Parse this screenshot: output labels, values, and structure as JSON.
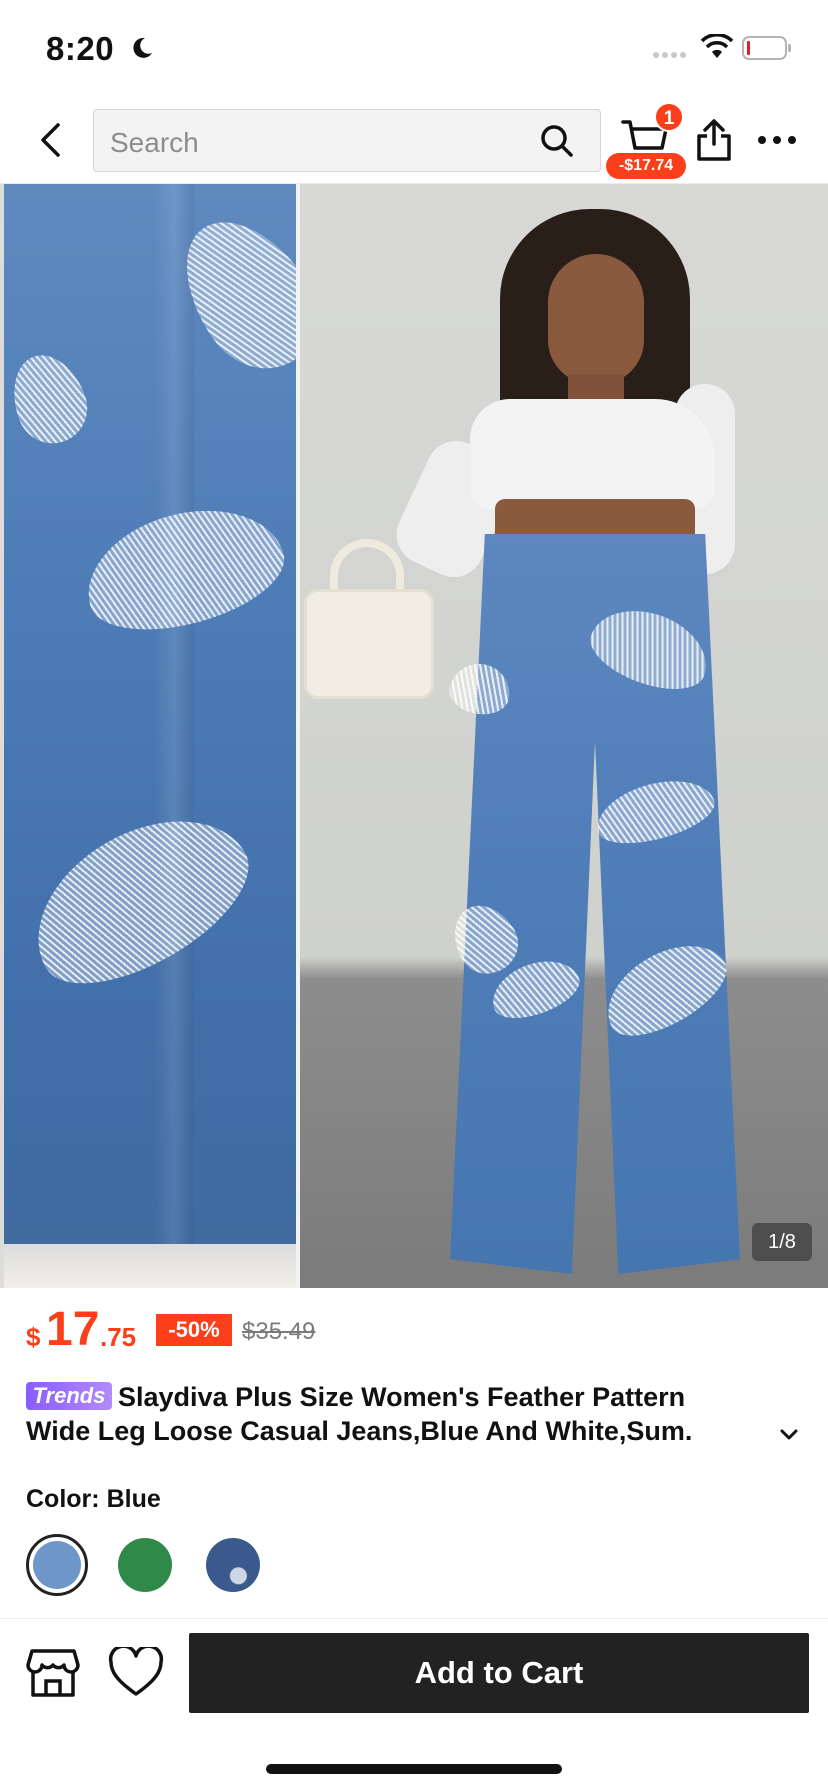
{
  "status_bar": {
    "time": "8:20"
  },
  "header": {
    "search_placeholder": "Search",
    "cart_badge_count": "1",
    "cart_discount": "-$17.74"
  },
  "gallery": {
    "page_indicator": "1/8",
    "current_page": 1,
    "total_pages": 8
  },
  "price": {
    "currency": "$",
    "integer": "17",
    "decimal": ".75",
    "discount": "-50%",
    "original": "$35.49",
    "accent_color": "#fa3f1a"
  },
  "product": {
    "trends_badge": "Trends",
    "title_line1": "Slaydiva Plus Size Women's Feather Pattern",
    "title_line2": "Wide Leg Loose Casual Jeans,Blue And White,Sum."
  },
  "color": {
    "label": "Color:",
    "selected": "Blue",
    "swatches": [
      "blue",
      "green",
      "navy-feather"
    ]
  },
  "bottom_bar": {
    "add_to_cart": "Add to Cart"
  },
  "icons": {
    "back": "chevron-left-icon",
    "search": "search-icon",
    "cart": "cart-icon",
    "share": "share-icon",
    "more": "more-icon",
    "store": "store-icon",
    "wishlist": "heart-icon",
    "expand": "chevron-down-icon"
  }
}
